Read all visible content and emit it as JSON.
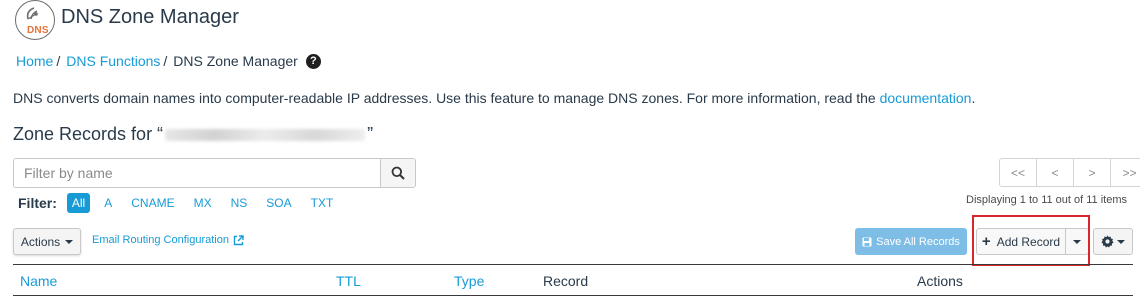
{
  "header": {
    "logo_text": "DNS",
    "title": "DNS Zone Manager"
  },
  "breadcrumb": {
    "items": [
      {
        "label": "Home"
      },
      {
        "label": "DNS Functions"
      }
    ],
    "current": "DNS Zone Manager",
    "help_icon": "question-circle-icon"
  },
  "description": {
    "text": "DNS converts domain names into computer-readable IP addresses. Use this feature to manage DNS zones. For more information, read the ",
    "link": "documentation",
    "suffix": "."
  },
  "zone": {
    "heading_prefix": "Zone Records for “",
    "heading_suffix": "”"
  },
  "search": {
    "placeholder": "Filter by name",
    "value": "",
    "icon": "search-icon"
  },
  "filter": {
    "label": "Filter:",
    "options": [
      "All",
      "A",
      "CNAME",
      "MX",
      "NS",
      "SOA",
      "TXT"
    ],
    "selected": "All"
  },
  "pagination": {
    "first": "<<",
    "prev": "<",
    "next": ">",
    "last": ">>",
    "info": "Displaying 1 to 11 out of 11 items"
  },
  "toolbar": {
    "actions_label": "Actions",
    "email_routing_label": "Email Routing Configuration",
    "save_all_label": "Save All Records",
    "add_record_label": "Add Record",
    "settings_icon": "gear-icon"
  },
  "table": {
    "columns": [
      "Name",
      "TTL",
      "Type",
      "Record",
      "Actions"
    ]
  },
  "colors": {
    "link": "#179bd7",
    "highlight": "#d9252b",
    "save_button": "#7dbde6",
    "logo_accent": "#e8733a"
  }
}
